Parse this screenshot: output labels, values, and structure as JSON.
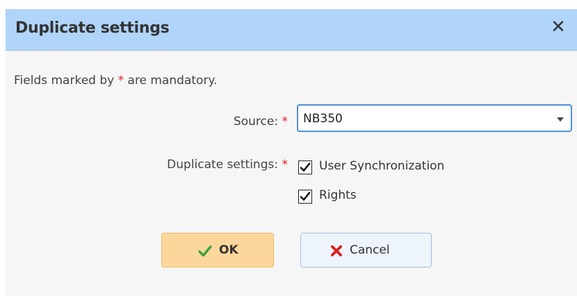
{
  "dialog": {
    "title": "Duplicate settings",
    "close_symbol": "✕"
  },
  "form": {
    "note_prefix": "Fields marked by ",
    "note_asterisk": "*",
    "note_suffix": " are mandatory.",
    "source_label": "Source:",
    "source_required": "*",
    "source_value": "NB350",
    "duplicate_label": "Duplicate settings:",
    "duplicate_required": "*",
    "options": [
      {
        "label": "User Synchronization",
        "checked": true
      },
      {
        "label": "Rights",
        "checked": true
      }
    ]
  },
  "buttons": {
    "ok_label": "OK",
    "ok_icon": "checkmark-icon",
    "cancel_label": "Cancel",
    "cancel_icon": "x-mark-icon"
  },
  "colors": {
    "titlebar": "#b0d4fa",
    "required": "#e0201c",
    "ok_button": "#fbd79b",
    "cancel_button": "#eef4fb",
    "select_border": "#4f8fd8"
  }
}
